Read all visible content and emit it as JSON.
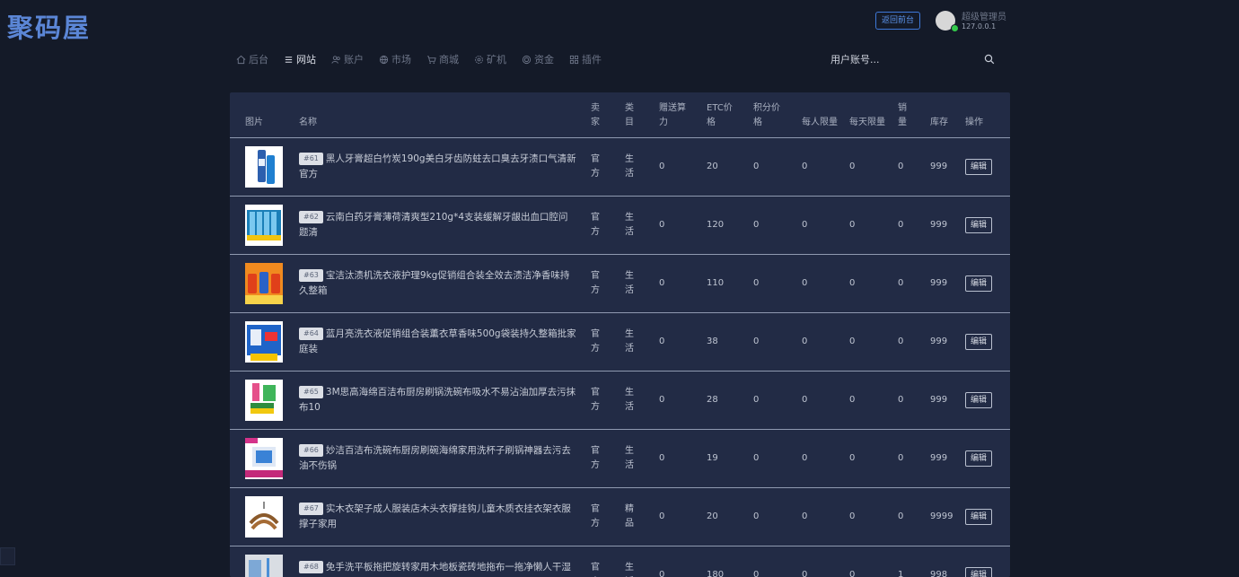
{
  "header": {
    "logo": "聚码屋",
    "front_button": "返回前台",
    "user_name": "超级管理员",
    "user_ip": "127.0.0.1"
  },
  "nav": [
    {
      "label": "后台",
      "icon": "home-icon",
      "active": false
    },
    {
      "label": "网站",
      "icon": "list-icon",
      "active": true
    },
    {
      "label": "账户",
      "icon": "users-icon",
      "active": false
    },
    {
      "label": "市场",
      "icon": "globe-icon",
      "active": false
    },
    {
      "label": "商城",
      "icon": "cart-icon",
      "active": false
    },
    {
      "label": "矿机",
      "icon": "gear-icon",
      "active": false
    },
    {
      "label": "资金",
      "icon": "coin-icon",
      "active": false
    },
    {
      "label": "插件",
      "icon": "grid-icon",
      "active": false
    }
  ],
  "search": {
    "placeholder": "用户账号..."
  },
  "table": {
    "headers": [
      "图片",
      "名称",
      "卖家",
      "类目",
      "赠送算力",
      "ETC价格",
      "积分价格",
      "每人限量",
      "每天限量",
      "销量",
      "库存",
      "操作"
    ],
    "edit_label": "编辑",
    "rows": [
      {
        "id": "#61",
        "name": "黑人牙膏超白竹炭190g美白牙齿防蛀去口臭去牙渍口气清新官方",
        "seller": "官方",
        "category": "生活",
        "bonus": "0",
        "etc": "20",
        "points": "0",
        "per_person": "0",
        "per_day": "0",
        "sales": "0",
        "stock": "999",
        "thumb": "toothpaste-black"
      },
      {
        "id": "#62",
        "name": "云南白药牙膏薄荷清爽型210g*4支装缓解牙龈出血口腔问题清",
        "seller": "官方",
        "category": "生活",
        "bonus": "0",
        "etc": "120",
        "points": "0",
        "per_person": "0",
        "per_day": "0",
        "sales": "0",
        "stock": "999",
        "thumb": "toothpaste-pack"
      },
      {
        "id": "#63",
        "name": "宝洁汰渍机洗衣液护理9kg促销组合装全效去渍洁净香味持久整箱",
        "seller": "官方",
        "category": "生活",
        "bonus": "0",
        "etc": "110",
        "points": "0",
        "per_person": "0",
        "per_day": "0",
        "sales": "0",
        "stock": "999",
        "thumb": "detergent-tide"
      },
      {
        "id": "#64",
        "name": "蓝月亮洗衣液促销组合装薰衣草香味500g袋装持久整箱批家庭装",
        "seller": "官方",
        "category": "生活",
        "bonus": "0",
        "etc": "38",
        "points": "0",
        "per_person": "0",
        "per_day": "0",
        "sales": "0",
        "stock": "999",
        "thumb": "detergent-bluemoon"
      },
      {
        "id": "#65",
        "name": "3M思高海绵百洁布厨房刷锅洗碗布吸水不易沾油加厚去污抹布10",
        "seller": "官方",
        "category": "生活",
        "bonus": "0",
        "etc": "28",
        "points": "0",
        "per_person": "0",
        "per_day": "0",
        "sales": "0",
        "stock": "999",
        "thumb": "sponge"
      },
      {
        "id": "#66",
        "name": "妙洁百洁布洗碗布厨房刷碗海绵家用洗杯子刷锅神器去污去油不伤锅",
        "seller": "官方",
        "category": "生活",
        "bonus": "0",
        "etc": "19",
        "points": "0",
        "per_person": "0",
        "per_day": "0",
        "sales": "0",
        "stock": "999",
        "thumb": "cleaning-cloth"
      },
      {
        "id": "#67",
        "name": "实木衣架子成人服装店木头衣撑挂钩儿童木质衣挂衣架衣服撑子家用",
        "seller": "官方",
        "category": "精品",
        "bonus": "0",
        "etc": "20",
        "points": "0",
        "per_person": "0",
        "per_day": "0",
        "sales": "0",
        "stock": "9999",
        "thumb": "hanger"
      },
      {
        "id": "#68",
        "name": "免手洗平板拖把旋转家用木地板瓷砖地拖布一拖净懒人干湿两用拖把",
        "seller": "官方",
        "category": "生活",
        "bonus": "0",
        "etc": "180",
        "points": "0",
        "per_person": "0",
        "per_day": "0",
        "sales": "1",
        "stock": "998",
        "thumb": "mop"
      }
    ]
  },
  "colors": {
    "background": "#141a28",
    "panel": "#222b45",
    "accent": "#5b86d6",
    "online": "#34c94b"
  }
}
